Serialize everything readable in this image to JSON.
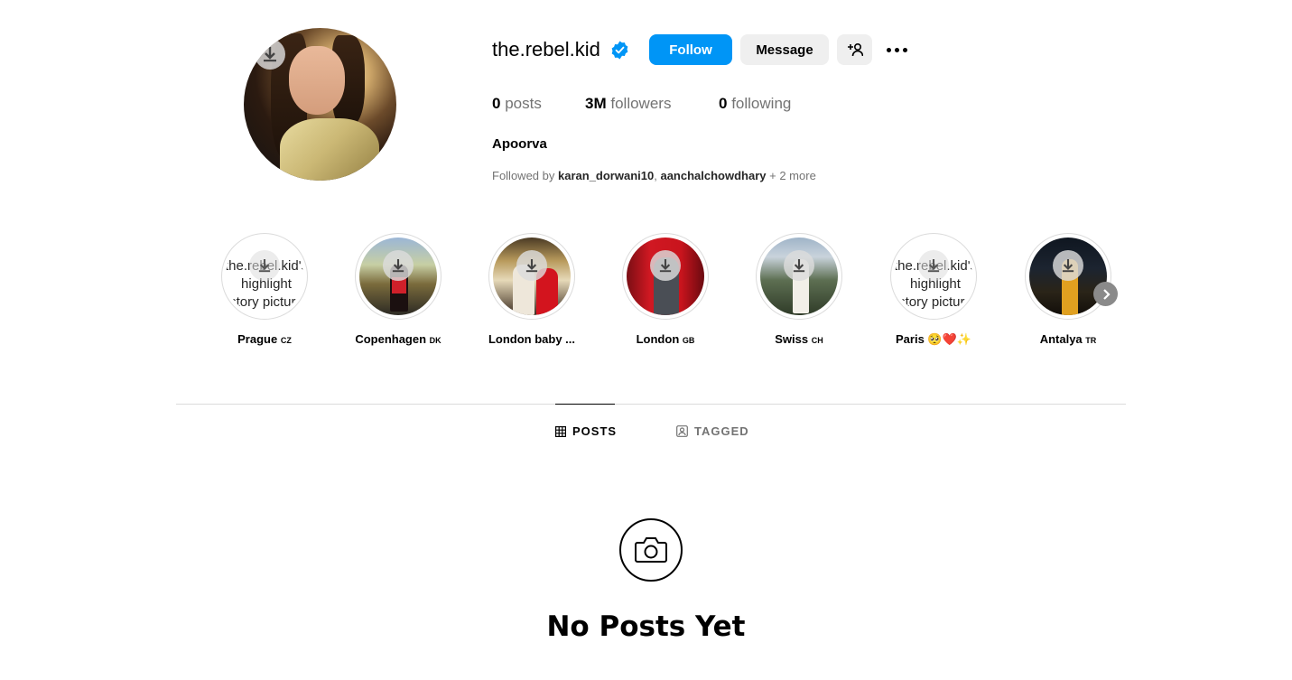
{
  "profile": {
    "username": "the.rebel.kid",
    "verified": true,
    "follow_label": "Follow",
    "message_label": "Message",
    "stats": {
      "posts_count": "0",
      "posts_label": "posts",
      "followers_count": "3M",
      "followers_label": "followers",
      "following_count": "0",
      "following_label": "following"
    },
    "full_name": "Apoorva",
    "followed_by": {
      "prefix": "Followed by",
      "user1": "karan_dorwani10",
      "separator": ",",
      "user2": "aanchalchowdhary",
      "more": "+ 2 more"
    }
  },
  "highlights": [
    {
      "name": "Prague",
      "flag": "CZ",
      "image": "broken",
      "alt_text": "the.rebel.kid's highlight story picture"
    },
    {
      "name": "Copenhagen",
      "flag": "DK",
      "image": "photo"
    },
    {
      "name": "London baby ...",
      "flag": "",
      "image": "photo"
    },
    {
      "name": "London",
      "flag": "GB",
      "image": "photo"
    },
    {
      "name": "Swiss",
      "flag": "CH",
      "image": "photo"
    },
    {
      "name": "Paris 🥺❤️✨",
      "flag": "",
      "image": "broken",
      "alt_text": "the.rebel.kid's highlight story picture"
    },
    {
      "name": "Antalya",
      "flag": "TR",
      "image": "photo"
    }
  ],
  "tabs": {
    "posts": "POSTS",
    "tagged": "TAGGED",
    "active": "posts"
  },
  "empty_state": {
    "title": "No Posts Yet",
    "icon": "camera-icon"
  },
  "colors": {
    "follow_button": "#0095f6",
    "secondary_button": "#efefef",
    "muted_text": "#737373",
    "verified_badge": "#0095f6"
  }
}
